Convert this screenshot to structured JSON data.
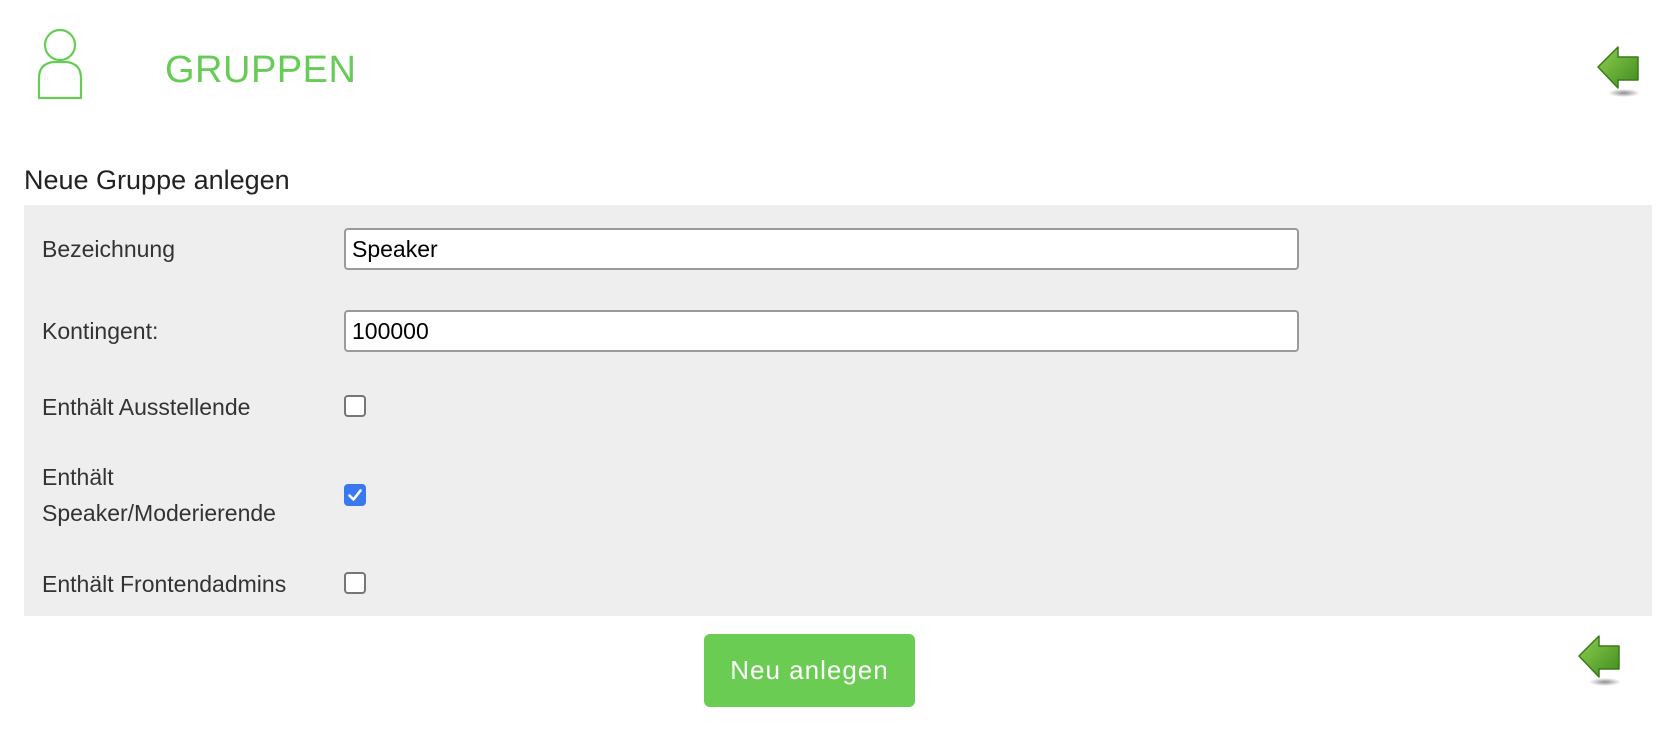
{
  "header": {
    "title": "GRUPPEN",
    "icon": "user-icon",
    "back_icon": "back-arrow-icon"
  },
  "form": {
    "title": "Neue Gruppe anlegen",
    "bezeichnung": {
      "label": "Bezeichnung",
      "value": "Speaker"
    },
    "kontingent": {
      "label": "Kontingent:",
      "value": "100000"
    },
    "ausstellende": {
      "label": "Enthält Ausstellende",
      "checked": false
    },
    "speaker": {
      "label_line1": "Enthält",
      "label_line2": "Speaker/Moderierende",
      "checked": true
    },
    "frontendadmins": {
      "label": "Enthält Frontendadmins",
      "checked": false
    },
    "submit_label": "Neu anlegen"
  },
  "colors": {
    "accent": "#66cc55",
    "button": "#6acc52",
    "panel": "#eeeeee",
    "checkbox_checked": "#3b78f0",
    "arrow": "#4f9a2a"
  }
}
